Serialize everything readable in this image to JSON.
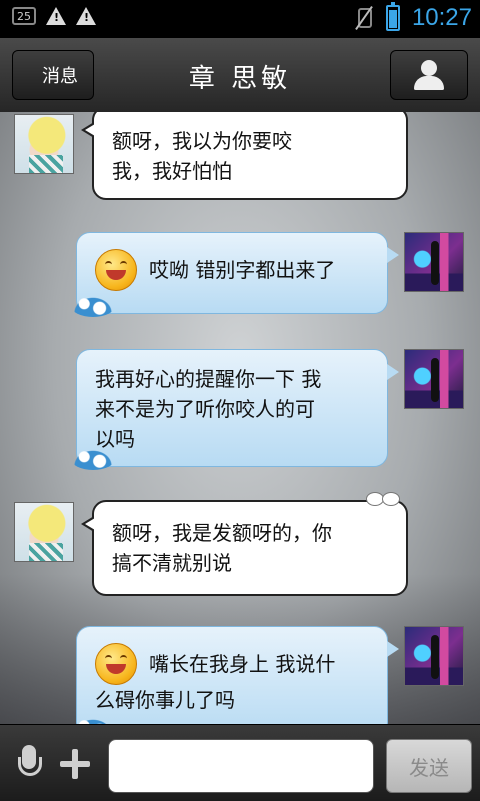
{
  "status_bar": {
    "notification_badge": "25",
    "time": "10:27",
    "battery_level_percent": 82
  },
  "header": {
    "back_label": "消息",
    "title": "章 思敏"
  },
  "messages": [
    {
      "side": "left",
      "lines": [
        "额呀，我以为你要咬",
        "我，我好怕怕"
      ]
    },
    {
      "side": "right",
      "emoji": "smiley-emoji",
      "lines": [
        "哎呦 错别字都出来了"
      ]
    },
    {
      "side": "right",
      "lines": [
        "我再好心的提醒你一下 我",
        "来不是为了听你咬人的可",
        "以吗"
      ]
    },
    {
      "side": "left",
      "lines": [
        "额呀，我是发额呀的，你",
        "搞不清就别说"
      ]
    },
    {
      "side": "right",
      "emoji": "smiley-emoji",
      "lines": [
        "嘴长在我身上 我说什",
        "么碍你事儿了吗"
      ]
    }
  ],
  "input_bar": {
    "placeholder": "",
    "send_label": "发送"
  },
  "colors": {
    "accent": "#3ba6e8",
    "right_bubble": "#b8dbf3",
    "left_bubble": "#ffffff"
  }
}
